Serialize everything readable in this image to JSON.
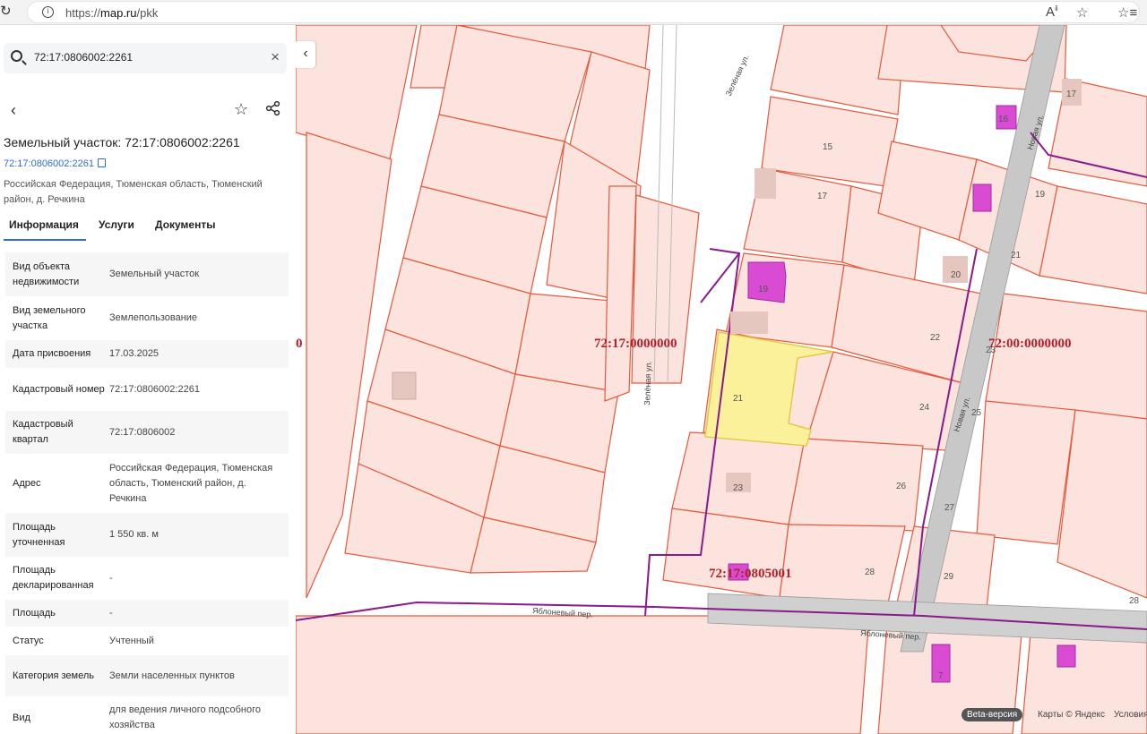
{
  "browser": {
    "url_prefix": "https://",
    "url_host": "map.ru",
    "url_path": "/pkk",
    "read_aloud_icon": "read-aloud-icon",
    "favorite_icon": "star-icon",
    "favorites_bar_icon": "favorites-icon"
  },
  "search": {
    "value": "72:17:0806002:2261"
  },
  "card": {
    "title": "Земельный участок: 72:17:0806002:2261",
    "cadastral_link": "72:17:0806002:2261",
    "address": "Российская Федерация, Тюменская область, Тюменский район, д. Речкина"
  },
  "tabs": [
    {
      "label": "Информация"
    },
    {
      "label": "Услуги"
    },
    {
      "label": "Документы"
    }
  ],
  "properties": [
    {
      "key": "Вид объекта недвижимости",
      "value": "Земельный участок"
    },
    {
      "key": "Вид земельного участка",
      "value": "Землепользование"
    },
    {
      "key": "Дата присвоения",
      "value": "17.03.2025"
    },
    {
      "key": "Кадастровый номер",
      "value": "72:17:0806002:2261"
    },
    {
      "key": "Кадастровый квартал",
      "value": "72:17:0806002"
    },
    {
      "key": "Адрес",
      "value": "Российская Федерация, Тюменская область, Тюменский район, д. Речкина"
    },
    {
      "key": "Площадь уточненная",
      "value": "1 550 кв. м"
    },
    {
      "key": "Площадь декларированная",
      "value": "-"
    },
    {
      "key": "Площадь",
      "value": "-"
    },
    {
      "key": "Статус",
      "value": "Учтенный"
    },
    {
      "key": "Категория земель",
      "value": "Земли населенных пунктов"
    },
    {
      "key": "Вид",
      "value": "для ведения личного подсобного хозяйства"
    }
  ],
  "map": {
    "quarter_labels": [
      "72:17:0000000",
      "72:00:0000000",
      "72:17:0805001",
      "0"
    ],
    "street_labels": [
      "Зелёная ул.",
      "Зелёная ул.",
      "Новая ул.",
      "Новая ул.",
      "Яблоневый пер.",
      "Яблоневый пер."
    ],
    "parcel_numbers": [
      "15",
      "16",
      "17",
      "17",
      "19",
      "19",
      "20",
      "21",
      "21",
      "22",
      "23",
      "23",
      "24",
      "25",
      "26",
      "27",
      "28",
      "28",
      "29",
      "7"
    ],
    "beta_badge": "Beta-версия",
    "copyright": "Карты © Яндекс",
    "terms": "Условия",
    "colors": {
      "parcel_fill": "#fce3dd",
      "parcel_stroke": "#e5593c",
      "selected_fill": "#faf19a",
      "quarter_line": "#8a1b8a",
      "building": "#e5c7c0",
      "highlight_building": "#d94bd2",
      "road": "#c8c8c8"
    }
  }
}
